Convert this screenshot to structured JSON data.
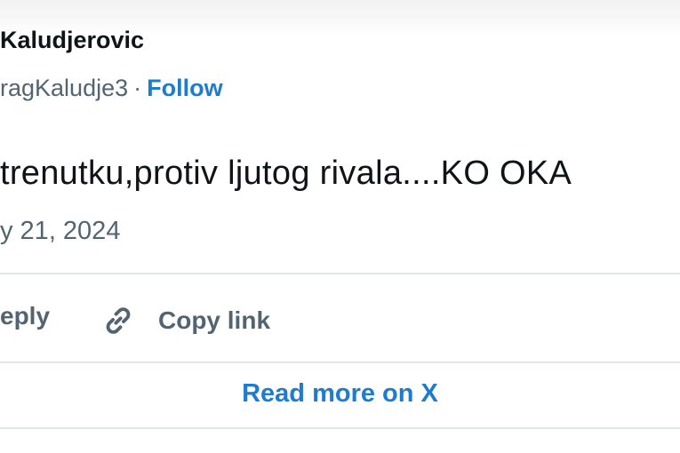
{
  "tweet": {
    "author_name": "Kaludjerovic",
    "handle": "ragKaludje3",
    "separator": "·",
    "follow_label": "Follow",
    "text": "trenutku,protiv ljutog rivala....KO OKA",
    "date": "y 21, 2024"
  },
  "actions": {
    "reply_label": "eply",
    "copy_link_label": "Copy link",
    "copy_link_icon": "link-icon"
  },
  "footer": {
    "read_more_label": "Read more on X"
  },
  "colors": {
    "accent": "#1d7bd0",
    "secondary_text": "#536471",
    "primary_text": "#0f1419",
    "divider": "#e1e6ea"
  }
}
